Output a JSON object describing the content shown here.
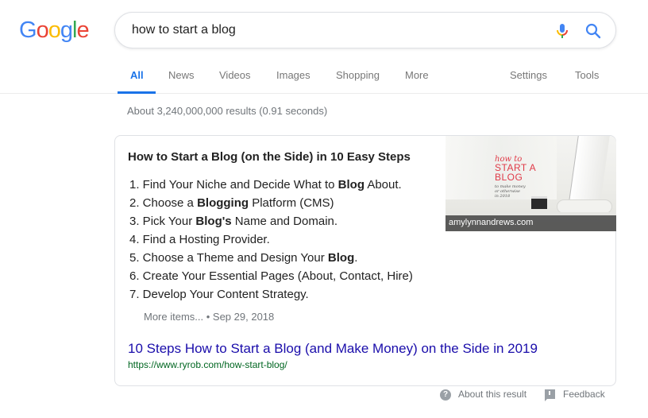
{
  "logo": {
    "letters": [
      "G",
      "o",
      "o",
      "g",
      "l",
      "e"
    ]
  },
  "search": {
    "query": "how to start a blog",
    "mic_icon": "microphone-icon",
    "search_icon": "magnifier-icon"
  },
  "tabs": {
    "items": [
      {
        "label": "All",
        "active": true
      },
      {
        "label": "News"
      },
      {
        "label": "Videos"
      },
      {
        "label": "Images"
      },
      {
        "label": "Shopping"
      },
      {
        "label": "More"
      }
    ],
    "settings": "Settings",
    "tools": "Tools"
  },
  "stats": "About 3,240,000,000 results (0.91 seconds)",
  "snippet": {
    "title": "How to Start a Blog (on the Side) in 10 Easy Steps",
    "steps": [
      {
        "num": "1.",
        "pre": " Find Your Niche and Decide What to ",
        "bold": "Blog",
        "post": " About."
      },
      {
        "num": "2.",
        "pre": " Choose a ",
        "bold": "Blogging",
        "post": " Platform (CMS)"
      },
      {
        "num": "3.",
        "pre": " Pick Your ",
        "bold": "Blog's",
        "post": " Name and Domain."
      },
      {
        "num": "4.",
        "pre": " Find a Hosting Provider.",
        "bold": "",
        "post": ""
      },
      {
        "num": "5.",
        "pre": " Choose a Theme and Design Your ",
        "bold": "Blog",
        "post": "."
      },
      {
        "num": "6.",
        "pre": " Create Your Essential Pages (About, Contact, Hire)",
        "bold": "",
        "post": ""
      },
      {
        "num": "7.",
        "pre": " Develop Your Content Strategy.",
        "bold": "",
        "post": ""
      }
    ],
    "more_items": "More items...",
    "separator": " • ",
    "date": "Sep 29, 2018",
    "image": {
      "line1": "how to",
      "line2a": "START A",
      "line2b": "BLOG",
      "line3a": "to make money",
      "line3b": "or otherwise",
      "line3c": "in 2018",
      "source": "amylynnandrews.com"
    },
    "link_title": "10 Steps How to Start a Blog (and Make Money) on the Side in 2019",
    "link_url": "https://www.ryrob.com/how-start-blog/"
  },
  "footer": {
    "about": "About this result",
    "feedback": "Feedback"
  },
  "colors": {
    "google_blue": "#4285f4",
    "google_red": "#ea4335",
    "google_yellow": "#fbbc05",
    "google_green": "#34a853",
    "active_tab": "#1a73e8",
    "link": "#1a0dab",
    "url": "#006621"
  }
}
